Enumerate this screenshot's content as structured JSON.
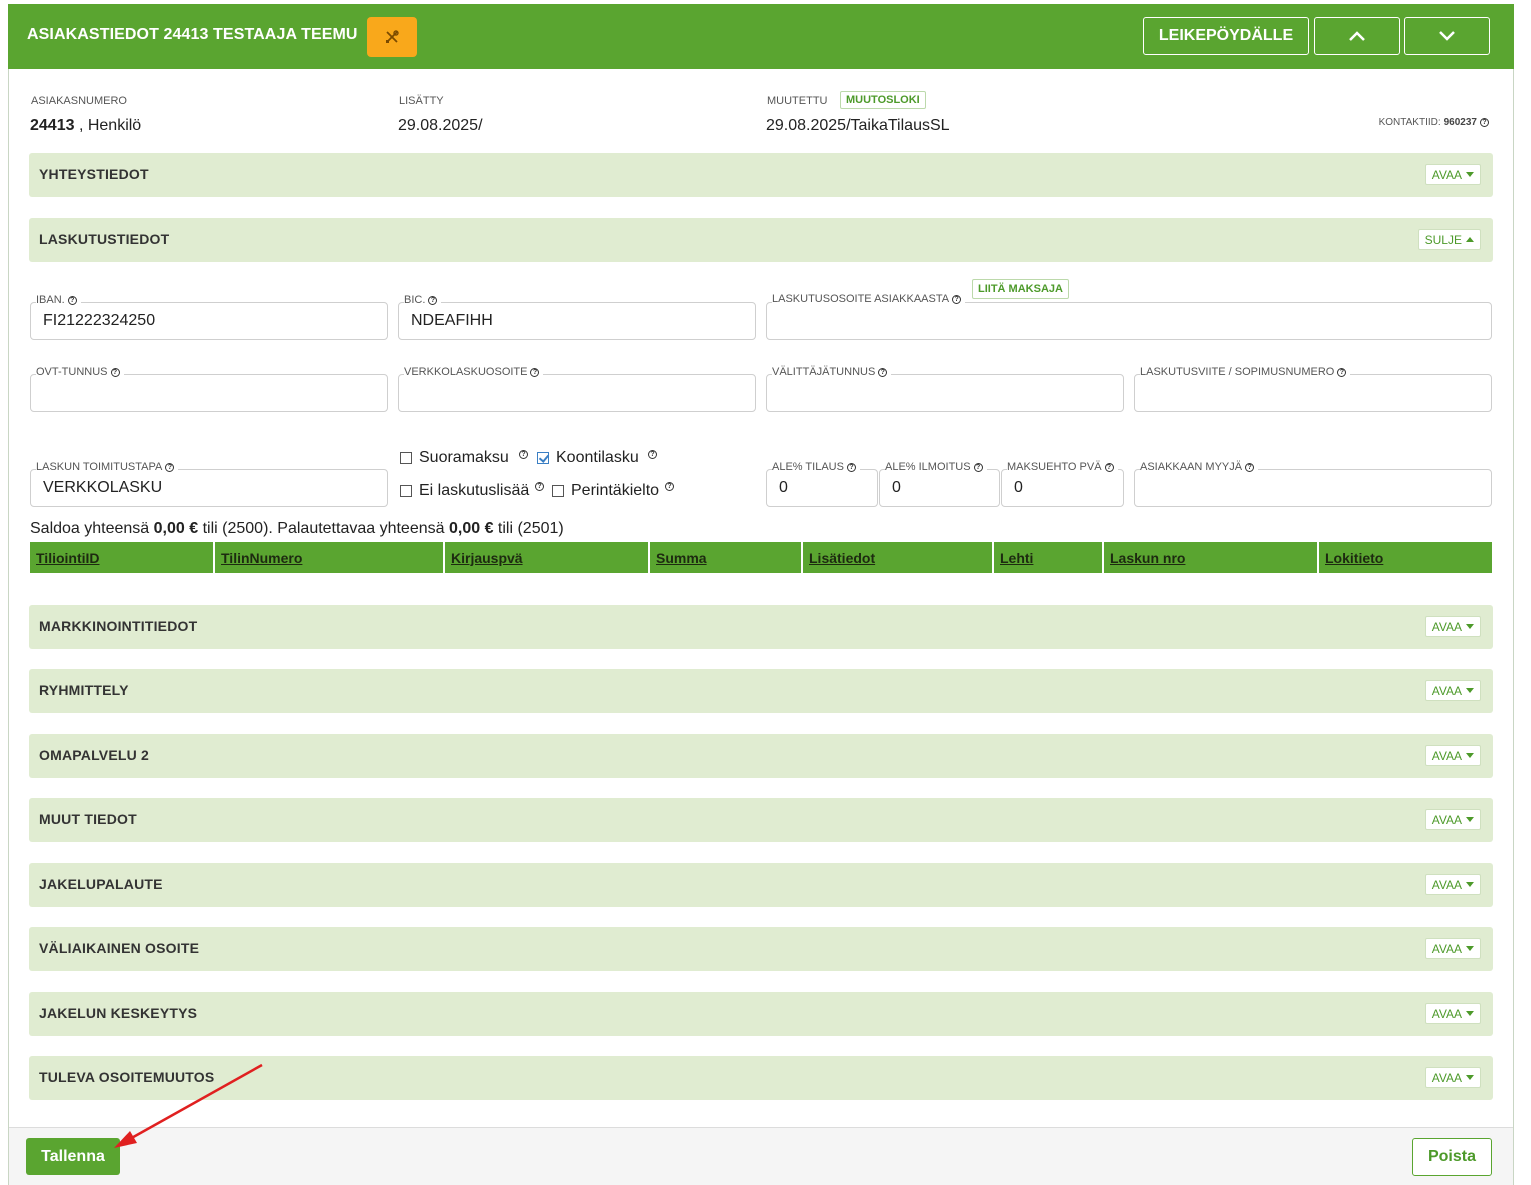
{
  "header": {
    "title": "ASIAKASTIEDOT 24413 TESTAAJA TEEMU",
    "tool_icon": "tools-icon",
    "clipboard_label": "LEIKEPÖYDÄLLE",
    "up_icon": "chevron-up-icon",
    "down_icon": "chevron-down-icon"
  },
  "meta": {
    "asiakasnumero_label": "ASIAKASNUMERO",
    "asiakasnumero": "24413",
    "asiakastyyppi": ", Henkilö",
    "lisatty_label": "LISÄTTY",
    "lisatty": "29.08.2025/",
    "muutettu_label": "MUUTETTU",
    "muutosloki_label": "MUUTOSLOKI",
    "muutettu": "29.08.2025/TaikaTilausSL",
    "kontaktiid_label": "KONTAKTIID:",
    "kontaktiid": "960237"
  },
  "sections": {
    "yhteystiedot": {
      "title": "YHTEYSTIEDOT",
      "btn": "AVAA"
    },
    "laskutustiedot": {
      "title": "LASKUTUSTIEDOT",
      "btn": "SULJE"
    },
    "markkinointitiedot": {
      "title": "MARKKINOINTITIEDOT",
      "btn": "AVAA"
    },
    "ryhmittely": {
      "title": "RYHMITTELY",
      "btn": "AVAA"
    },
    "omapalvelu": {
      "title": "OMAPALVELU 2",
      "btn": "AVAA"
    },
    "muut": {
      "title": "MUUT TIEDOT",
      "btn": "AVAA"
    },
    "jakelupalaute": {
      "title": "JAKELUPALAUTE",
      "btn": "AVAA"
    },
    "valiaikainen": {
      "title": "VÄLIAIKAINEN OSOITE",
      "btn": "AVAA"
    },
    "keskeytys": {
      "title": "JAKELUN KESKEYTYS",
      "btn": "AVAA"
    },
    "tuleva": {
      "title": "TULEVA OSOITEMUUTOS",
      "btn": "AVAA"
    }
  },
  "billing": {
    "iban_label": "IBAN.",
    "iban": "FI21222324250",
    "bic_label": "BIC.",
    "bic": "NDEAFIHH",
    "laskutusosoite_label": "LASKUTUSOSOITE ASIAKKAASTA",
    "liita_label": "LIITÄ MAKSAJA",
    "laskutusosoite": "",
    "ovt_label": "OVT-TUNNUS",
    "ovt": "",
    "verkkolaskuosoite_label": "VERKKOLASKUOSOITE",
    "verkkolaskuosoite": "",
    "valittaja_label": "VÄLITTÄJÄTUNNUS",
    "valittaja": "",
    "viite_label": "LASKUTUSVIITE / SOPIMUSNUMERO",
    "viite": "",
    "toimitustapa_label": "LASKUN TOIMITUSTAPA",
    "toimitustapa": "VERKKOLASKU",
    "suoramaksu": "Suoramaksu",
    "koontilasku": "Koontilasku",
    "ei_laskutuslisaa": "Ei laskutuslisää",
    "perintakielto": "Perintäkielto",
    "ale_tilaus_label": "ALE% TILAUS",
    "ale_tilaus": "0",
    "ale_ilmoitus_label": "ALE% ILMOITUS",
    "ale_ilmoitus": "0",
    "maksuehto_label": "MAKSUEHTO PVÄ",
    "maksuehto": "0",
    "myyja_label": "ASIAKKAAN MYYJÄ",
    "myyja": ""
  },
  "saldo": {
    "prefix": "Saldoa yhteensä",
    "saldo_amount": "0,00 €",
    "saldo_suffix": "tili (2500). Palautettavaa yhteensä",
    "palautettava_amount": "0,00 €",
    "palautettava_suffix": "tili (2501)"
  },
  "table": {
    "columns": [
      "TiliointiID",
      "TilinNumero",
      "Kirjauspvä",
      "Summa",
      "Lisätiedot",
      "Lehti",
      "Laskun nro",
      "Lokitieto"
    ]
  },
  "footer": {
    "save_label": "Tallenna",
    "delete_label": "Poista"
  },
  "colors": {
    "brand_green": "#5aa530",
    "section_bg": "#e0ecd1",
    "tool_orange": "#f9a81b",
    "annotation_arrow": "#e02020"
  }
}
